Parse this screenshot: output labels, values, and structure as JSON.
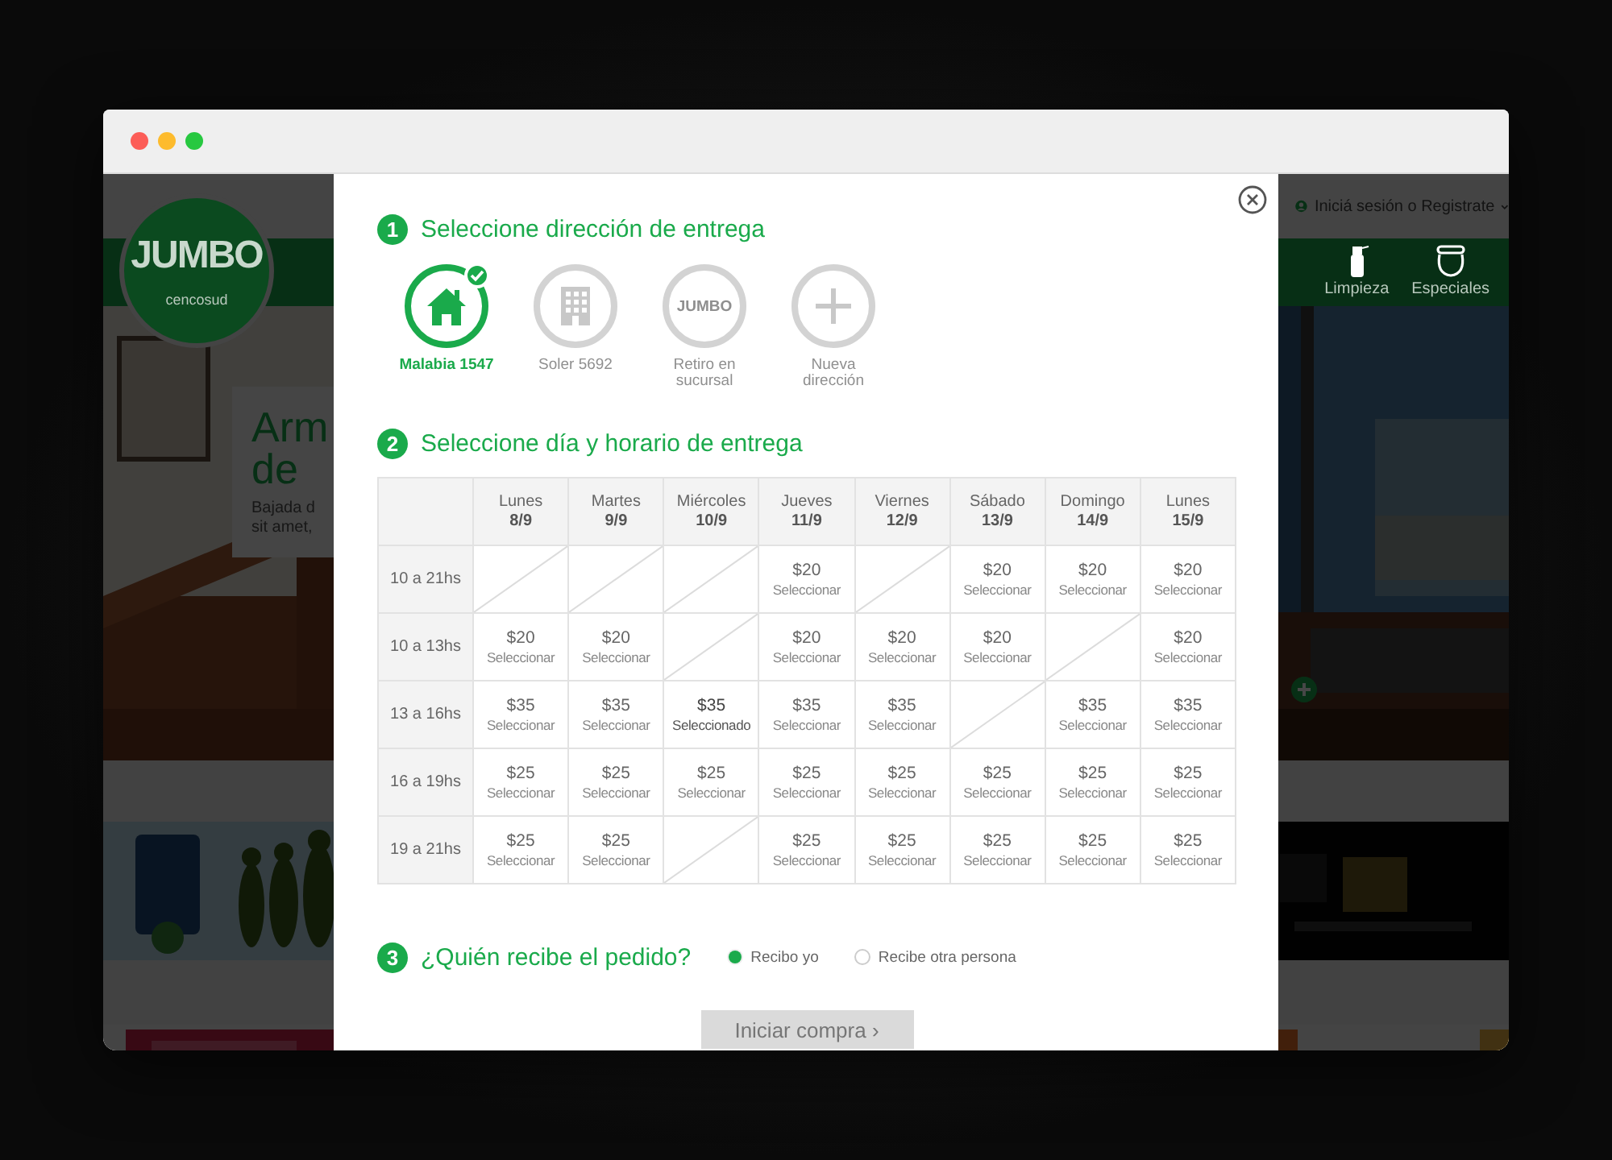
{
  "background": {
    "logo": {
      "name": "JUMBO",
      "subtitle": "cencosud"
    },
    "login_link": "Iniciá sesión o Registrate",
    "nav_items": [
      {
        "label": "Limpieza"
      },
      {
        "label": "Especiales"
      }
    ],
    "hero": {
      "title_lines": [
        "Arm",
        "de"
      ],
      "text_lines": [
        "Bajada d",
        "sit amet,"
      ]
    }
  },
  "modal": {
    "address_step": {
      "number": "1",
      "title": "Seleccione dirección de entrega",
      "options": [
        {
          "kind": "home",
          "label": "Malabia 1547",
          "selected": true
        },
        {
          "kind": "building",
          "label": "Soler 5692",
          "selected": false
        },
        {
          "kind": "store",
          "logo_text": "JUMBO",
          "label": "Retiro en sucursal",
          "selected": false
        },
        {
          "kind": "add",
          "label": "Nueva dirección",
          "selected": false
        }
      ]
    },
    "schedule_step": {
      "number": "2",
      "title": "Seleccione día y horario de entrega",
      "days": [
        {
          "day": "Lunes",
          "date": "8/9"
        },
        {
          "day": "Martes",
          "date": "9/9"
        },
        {
          "day": "Miércoles",
          "date": "10/9"
        },
        {
          "day": "Jueves",
          "date": "11/9"
        },
        {
          "day": "Viernes",
          "date": "12/9"
        },
        {
          "day": "Sábado",
          "date": "13/9"
        },
        {
          "day": "Domingo",
          "date": "14/9"
        },
        {
          "day": "Lunes",
          "date": "15/9"
        }
      ],
      "rows": [
        {
          "time": "10 a 21hs",
          "slots": [
            {
              "kind": "unavailable"
            },
            {
              "kind": "unavailable"
            },
            {
              "kind": "unavailable"
            },
            {
              "kind": "slot",
              "price": "$20",
              "action": "Seleccionar",
              "selected": false
            },
            {
              "kind": "unavailable"
            },
            {
              "kind": "slot",
              "price": "$20",
              "action": "Seleccionar",
              "selected": false
            },
            {
              "kind": "slot",
              "price": "$20",
              "action": "Seleccionar",
              "selected": false
            },
            {
              "kind": "slot",
              "price": "$20",
              "action": "Seleccionar",
              "selected": false
            }
          ]
        },
        {
          "time": "10 a 13hs",
          "slots": [
            {
              "kind": "slot",
              "price": "$20",
              "action": "Seleccionar",
              "selected": false
            },
            {
              "kind": "slot",
              "price": "$20",
              "action": "Seleccionar",
              "selected": false
            },
            {
              "kind": "unavailable"
            },
            {
              "kind": "slot",
              "price": "$20",
              "action": "Seleccionar",
              "selected": false
            },
            {
              "kind": "slot",
              "price": "$20",
              "action": "Seleccionar",
              "selected": false
            },
            {
              "kind": "slot",
              "price": "$20",
              "action": "Seleccionar",
              "selected": false
            },
            {
              "kind": "unavailable"
            },
            {
              "kind": "slot",
              "price": "$20",
              "action": "Seleccionar",
              "selected": false
            }
          ]
        },
        {
          "time": "13 a 16hs",
          "slots": [
            {
              "kind": "slot",
              "price": "$35",
              "action": "Seleccionar",
              "selected": false
            },
            {
              "kind": "slot",
              "price": "$35",
              "action": "Seleccionar",
              "selected": false
            },
            {
              "kind": "slot",
              "price": "$35",
              "action": "Seleccionado",
              "selected": true
            },
            {
              "kind": "slot",
              "price": "$35",
              "action": "Seleccionar",
              "selected": false
            },
            {
              "kind": "slot",
              "price": "$35",
              "action": "Seleccionar",
              "selected": false
            },
            {
              "kind": "unavailable"
            },
            {
              "kind": "slot",
              "price": "$35",
              "action": "Seleccionar",
              "selected": false
            },
            {
              "kind": "slot",
              "price": "$35",
              "action": "Seleccionar",
              "selected": false
            }
          ]
        },
        {
          "time": "16 a 19hs",
          "slots": [
            {
              "kind": "slot",
              "price": "$25",
              "action": "Seleccionar",
              "selected": false
            },
            {
              "kind": "slot",
              "price": "$25",
              "action": "Seleccionar",
              "selected": false
            },
            {
              "kind": "slot",
              "price": "$25",
              "action": "Seleccionar",
              "selected": false
            },
            {
              "kind": "slot",
              "price": "$25",
              "action": "Seleccionar",
              "selected": false
            },
            {
              "kind": "slot",
              "price": "$25",
              "action": "Seleccionar",
              "selected": false
            },
            {
              "kind": "slot",
              "price": "$25",
              "action": "Seleccionar",
              "selected": false
            },
            {
              "kind": "slot",
              "price": "$25",
              "action": "Seleccionar",
              "selected": false
            },
            {
              "kind": "slot",
              "price": "$25",
              "action": "Seleccionar",
              "selected": false
            }
          ]
        },
        {
          "time": "19 a 21hs",
          "slots": [
            {
              "kind": "slot",
              "price": "$25",
              "action": "Seleccionar",
              "selected": false
            },
            {
              "kind": "slot",
              "price": "$25",
              "action": "Seleccionar",
              "selected": false
            },
            {
              "kind": "unavailable"
            },
            {
              "kind": "slot",
              "price": "$25",
              "action": "Seleccionar",
              "selected": false
            },
            {
              "kind": "slot",
              "price": "$25",
              "action": "Seleccionar",
              "selected": false
            },
            {
              "kind": "slot",
              "price": "$25",
              "action": "Seleccionar",
              "selected": false
            },
            {
              "kind": "slot",
              "price": "$25",
              "action": "Seleccionar",
              "selected": false
            },
            {
              "kind": "slot",
              "price": "$25",
              "action": "Seleccionar",
              "selected": false
            }
          ]
        }
      ]
    },
    "recipient_step": {
      "number": "3",
      "title": "¿Quién recibe el pedido?",
      "options": [
        {
          "label": "Recibo yo",
          "selected": true
        },
        {
          "label": "Recibe otra persona",
          "selected": false
        }
      ]
    },
    "submit": {
      "label": "Iniciar compra ›",
      "disabled": true
    }
  }
}
